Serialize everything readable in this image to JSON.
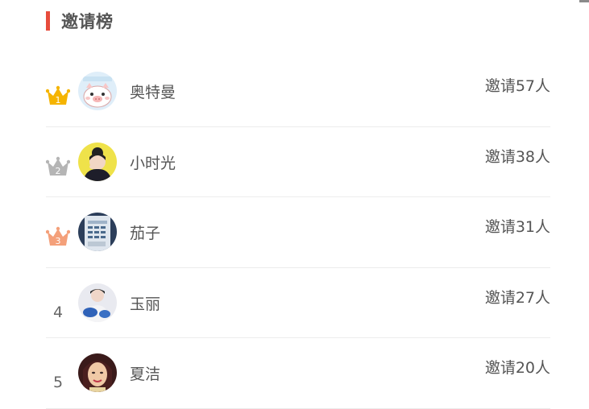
{
  "header": {
    "title": "邀请榜",
    "accent_color": "#e74c3c"
  },
  "rows": [
    {
      "rank": "1",
      "rank_icon": "crown-icon",
      "crown_color": "#f5b400",
      "name": "奥特曼",
      "invite_text": "邀请57人",
      "avatar": "pig-avatar"
    },
    {
      "rank": "2",
      "rank_icon": "crown-icon",
      "crown_color": "#b5b5b5",
      "name": "小时光",
      "invite_text": "邀请38人",
      "avatar": "girl-yellow-avatar"
    },
    {
      "rank": "3",
      "rank_icon": "crown-icon",
      "crown_color": "#f4a07a",
      "name": "茄子",
      "invite_text": "邀请31人",
      "avatar": "machine-avatar"
    },
    {
      "rank": "4",
      "name": "玉丽",
      "invite_text": "邀请27人",
      "avatar": "person-blue-avatar"
    },
    {
      "rank": "5",
      "name": "夏洁",
      "invite_text": "邀请20人",
      "avatar": "woman-portrait-avatar"
    }
  ]
}
